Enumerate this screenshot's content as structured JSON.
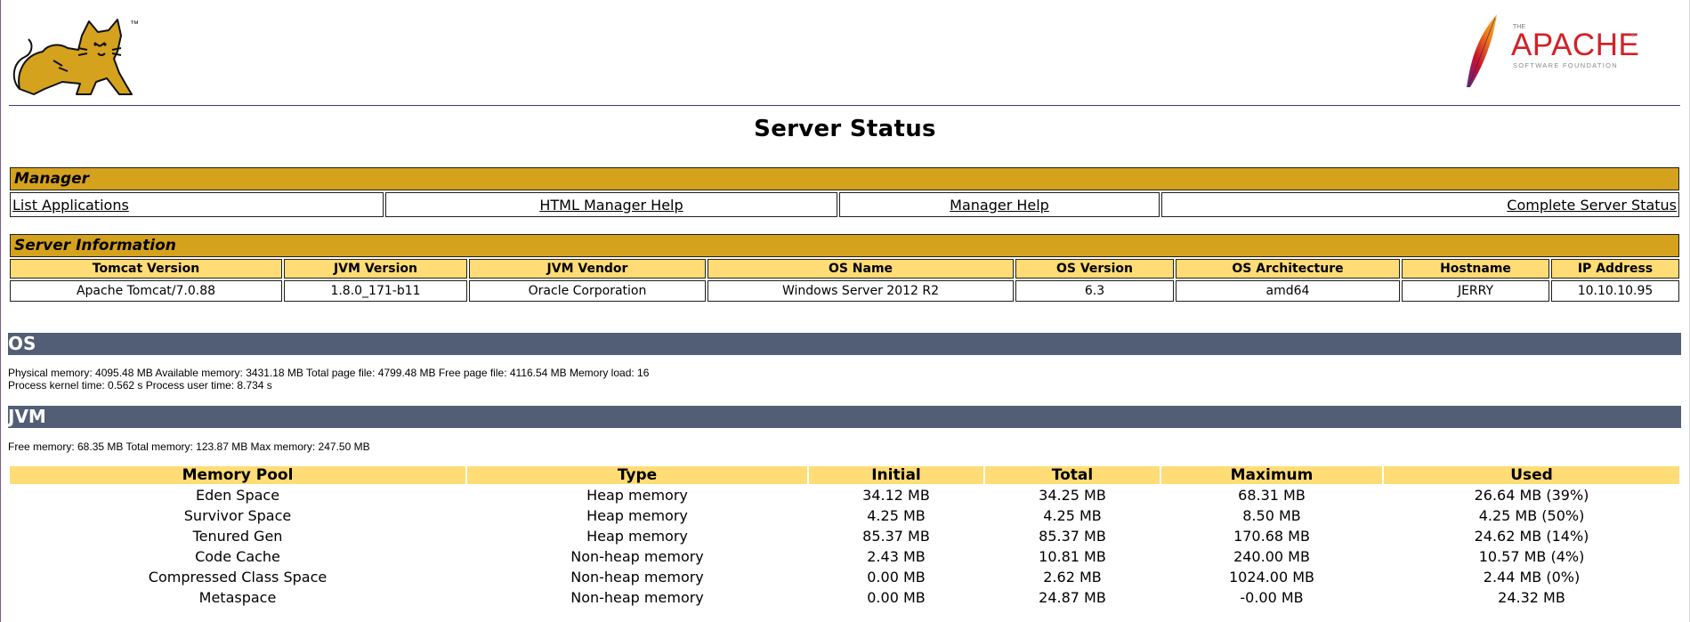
{
  "header": {
    "tomcat_logo_name": "tomcat-logo",
    "tomcat_trademark": "™",
    "apache_small_top": "THE",
    "apache_wordmark": "APACHE",
    "apache_registered": "®",
    "apache_foundation": "SOFTWARE FOUNDATION"
  },
  "page_title": "Server Status",
  "manager": {
    "title": "Manager",
    "links": [
      "List Applications",
      "HTML Manager Help",
      "Manager Help",
      "Complete Server Status"
    ]
  },
  "server_info": {
    "title": "Server Information",
    "columns": [
      "Tomcat Version",
      "JVM Version",
      "JVM Vendor",
      "OS Name",
      "OS Version",
      "OS Architecture",
      "Hostname",
      "IP Address"
    ],
    "values": [
      "Apache Tomcat/7.0.88",
      "1.8.0_171-b11",
      "Oracle Corporation",
      "Windows Server 2012 R2",
      "6.3",
      "amd64",
      "JERRY",
      "10.10.10.95"
    ]
  },
  "os": {
    "title": "OS",
    "line1": "Physical memory: 4095.48 MB Available memory: 3431.18 MB Total page file: 4799.48 MB Free page file: 4116.54 MB Memory load: 16",
    "line2": "Process kernel time: 0.562 s Process user time: 8.734 s"
  },
  "jvm": {
    "title": "JVM",
    "memory_line": "Free memory: 68.35 MB Total memory: 123.87 MB Max memory: 247.50 MB",
    "pool_columns": [
      "Memory Pool",
      "Type",
      "Initial",
      "Total",
      "Maximum",
      "Used"
    ],
    "pools": [
      [
        "Eden Space",
        "Heap memory",
        "34.12 MB",
        "34.25 MB",
        "68.31 MB",
        "26.64 MB (39%)"
      ],
      [
        "Survivor Space",
        "Heap memory",
        "4.25 MB",
        "4.25 MB",
        "8.50 MB",
        "4.25 MB (50%)"
      ],
      [
        "Tenured Gen",
        "Heap memory",
        "85.37 MB",
        "85.37 MB",
        "170.68 MB",
        "24.62 MB (14%)"
      ],
      [
        "Code Cache",
        "Non-heap memory",
        "2.43 MB",
        "10.81 MB",
        "240.00 MB",
        "10.57 MB (4%)"
      ],
      [
        "Compressed Class Space",
        "Non-heap memory",
        "0.00 MB",
        "2.62 MB",
        "1024.00 MB",
        "2.44 MB (0%)"
      ],
      [
        "Metaspace",
        "Non-heap memory",
        "0.00 MB",
        "24.87 MB",
        "-0.00 MB",
        "24.32 MB"
      ]
    ]
  },
  "colors": {
    "manager_bar": "#d4a21d",
    "header_cell": "#ffdc75",
    "section_bar": "#525d76",
    "apache_red": "#d22128"
  }
}
